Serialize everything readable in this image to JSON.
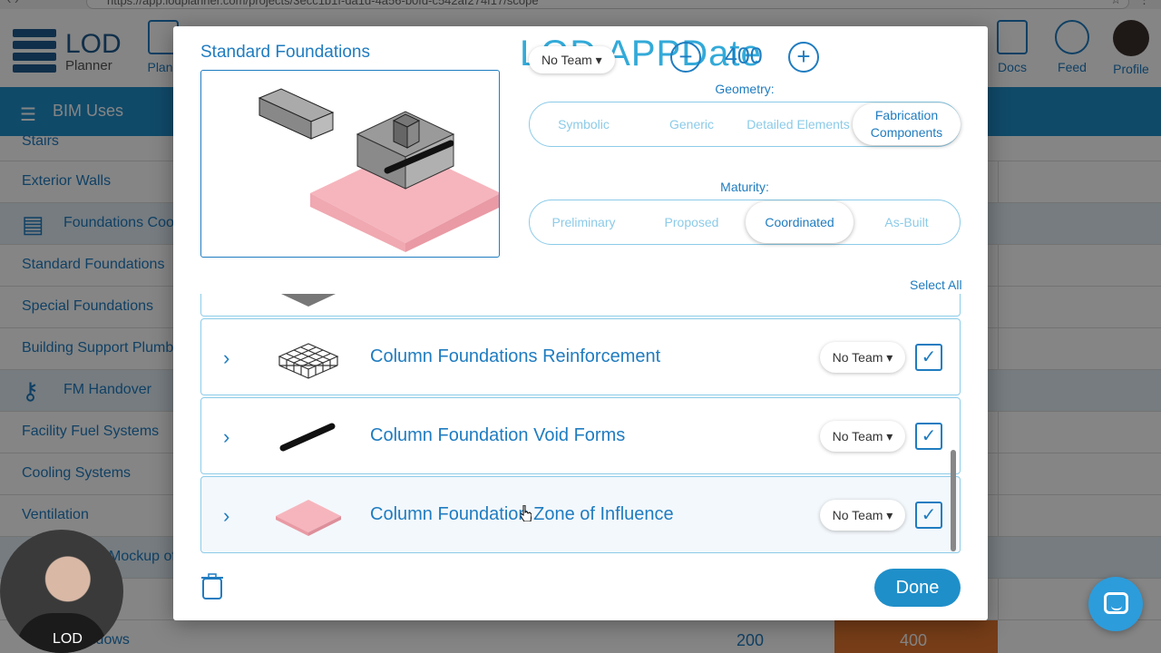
{
  "browser": {
    "url": "https://app.lodplanner.com/projects/3ecc1b1f-da1d-4a56-b0fd-c542af274f17/scope"
  },
  "app": {
    "logo": {
      "line1": "LOD",
      "line2": "Planner"
    },
    "nav": [
      {
        "label": "Plans"
      },
      {
        "label": "Docs"
      },
      {
        "label": "Feed"
      },
      {
        "label": "Profile"
      }
    ],
    "sidebar": {
      "header": "BIM Uses",
      "items": [
        {
          "label": "Stairs"
        },
        {
          "label": "Exterior Walls"
        },
        {
          "label": "Foundations Coordination"
        },
        {
          "label": "Standard Foundations"
        },
        {
          "label": "Special Foundations"
        },
        {
          "label": "Building Support Plumbing"
        },
        {
          "label": "FM Handover"
        },
        {
          "label": "Facility Fuel Systems"
        },
        {
          "label": "Cooling Systems"
        },
        {
          "label": "Ventilation"
        },
        {
          "label": "Mockup of"
        },
        {
          "label": "Windows"
        }
      ],
      "bottom_values": [
        "200",
        "400"
      ]
    }
  },
  "modal": {
    "title": "Standard Foundations",
    "lod_title": "LOD APPDate",
    "lod_value": "400",
    "team_top": "No Team",
    "geometry": {
      "label": "Geometry:",
      "options": [
        "Symbolic",
        "Generic",
        "Detailed Elements",
        "Fabrication Components"
      ],
      "selected": "Fabrication Components"
    },
    "maturity": {
      "label": "Maturity:",
      "options": [
        "Preliminary",
        "Proposed",
        "Coordinated",
        "As-Built"
      ],
      "selected": "Coordinated"
    },
    "select_all": "Select All",
    "components": [
      {
        "name": "Column Foundations Reinforcement",
        "team": "No Team",
        "checked": true,
        "thumb": "rebar-cage"
      },
      {
        "name": "Column Foundation Void Forms",
        "team": "No Team",
        "checked": true,
        "thumb": "void-tube"
      },
      {
        "name": "Column Foundation Zone of Influence",
        "team": "No Team",
        "checked": true,
        "thumb": "zone-pyramid"
      }
    ],
    "done_label": "Done"
  },
  "webcam": {
    "shirt_text": "LOD"
  },
  "colors": {
    "accent": "#1f7cc0",
    "brand": "#1f8fc9",
    "zone": "#f2a7b0"
  }
}
